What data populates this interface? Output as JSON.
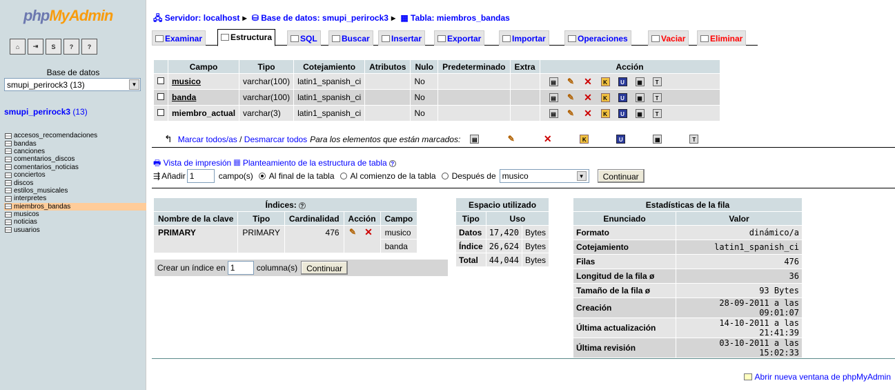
{
  "sidebar": {
    "logo_php": "php",
    "logo_myadmin": "MyAdmin",
    "db_label": "Base de datos",
    "db_select": "smupi_perirock3 (13)",
    "db_title": "smupi_perirock3",
    "db_count": "(13)",
    "tables": [
      "accesos_recomendaciones",
      "bandas",
      "canciones",
      "comentarios_discos",
      "comentarios_noticias",
      "conciertos",
      "discos",
      "estilos_musicales",
      "interpretes",
      "miembros_bandas",
      "musicos",
      "noticias",
      "usuarios"
    ],
    "selected_table": "miembros_bandas"
  },
  "breadcrumb": {
    "server": "Servidor: localhost",
    "database": "Base de datos: smupi_perirock3",
    "table": "Tabla: miembros_bandas"
  },
  "tabs": [
    "Examinar",
    "Estructura",
    "SQL",
    "Buscar",
    "Insertar",
    "Exportar",
    "Importar",
    "Operaciones",
    "Vaciar",
    "Eliminar"
  ],
  "structure": {
    "headers": [
      "Campo",
      "Tipo",
      "Cotejamiento",
      "Atributos",
      "Nulo",
      "Predeterminado",
      "Extra",
      "Acción"
    ],
    "rows": [
      {
        "campo": "musico",
        "tipo": "varchar(100)",
        "cotejamiento": "latin1_spanish_ci",
        "atributos": "",
        "nulo": "No",
        "predeterminado": "",
        "extra": ""
      },
      {
        "campo": "banda",
        "tipo": "varchar(100)",
        "cotejamiento": "latin1_spanish_ci",
        "atributos": "",
        "nulo": "No",
        "predeterminado": "",
        "extra": ""
      },
      {
        "campo": "miembro_actual",
        "tipo": "varchar(3)",
        "cotejamiento": "latin1_spanish_ci",
        "atributos": "",
        "nulo": "No",
        "predeterminado": "",
        "extra": ""
      }
    ],
    "mark_all": "Marcar todos/as",
    "unmark_all": "Desmarcar todos",
    "marked_text": "Para los elementos que están marcados:"
  },
  "tools": {
    "print_view": "Vista de impresión",
    "propose": "Planteamiento de la estructura de tabla",
    "add_label": "Añadir",
    "add_value": "1",
    "fields_label": "campo(s)",
    "opt_end": "Al final de la tabla",
    "opt_begin": "Al comienzo de la tabla",
    "opt_after": "Después de",
    "after_select": "musico",
    "continue": "Continuar"
  },
  "indexes": {
    "title": "Índices:",
    "headers": [
      "Nombre de la clave",
      "Tipo",
      "Cardinalidad",
      "Acción",
      "Campo"
    ],
    "row": {
      "nombre": "PRIMARY",
      "tipo": "PRIMARY",
      "cardinalidad": "476",
      "campo1": "musico",
      "campo2": "banda"
    },
    "create_label": "Crear un índice en",
    "create_value": "1",
    "columns_label": "columna(s)",
    "continue": "Continuar"
  },
  "space": {
    "title": "Espacio utilizado",
    "headers": [
      "Tipo",
      "Uso"
    ],
    "rows": [
      {
        "tipo": "Datos",
        "valor": "17,420",
        "unidad": "Bytes"
      },
      {
        "tipo": "Índice",
        "valor": "26,624",
        "unidad": "Bytes"
      },
      {
        "tipo": "Total",
        "valor": "44,044",
        "unidad": "Bytes"
      }
    ]
  },
  "rowstats": {
    "title": "Estadísticas de la fila",
    "headers": [
      "Enunciado",
      "Valor"
    ],
    "rows": [
      {
        "k": "Formato",
        "v": "dinámico/a"
      },
      {
        "k": "Cotejamiento",
        "v": "latin1_spanish_ci"
      },
      {
        "k": "Filas",
        "v": "476"
      },
      {
        "k": "Longitud de la fila ø",
        "v": "36"
      },
      {
        "k": "Tamaño de la fila ø",
        "v": "93 Bytes"
      },
      {
        "k": "Creación",
        "v": "28-09-2011 a las 09:01:07"
      },
      {
        "k": "Última actualización",
        "v": "14-10-2011 a las 21:41:39"
      },
      {
        "k": "Última revisión",
        "v": "03-10-2011 a las 15:02:33"
      }
    ]
  },
  "footer": {
    "new_window": "Abrir nueva ventana de phpMyAdmin"
  }
}
